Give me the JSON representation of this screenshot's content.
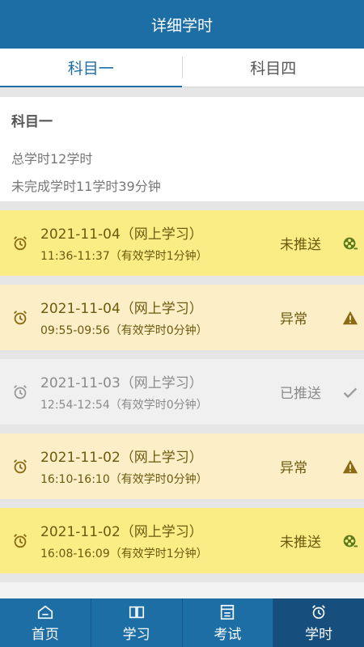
{
  "header": {
    "title": "详细学时"
  },
  "tabs": [
    {
      "label": "科目一",
      "active": true
    },
    {
      "label": "科目四",
      "active": false
    }
  ],
  "summary": {
    "subject": "科目一",
    "total": "总学时12学时",
    "remaining": "未完成学时11学时39分钟"
  },
  "records": [
    {
      "date": "2021-11-04（网上学习）",
      "time": "11:36-11:37（有效学时1分钟）",
      "status": "未推送",
      "status_icon": "film-reel-icon",
      "theme": "yellow"
    },
    {
      "date": "2021-11-04（网上学习）",
      "time": "09:55-09:56（有效学时0分钟）",
      "status": "异常",
      "status_icon": "warning-icon",
      "theme": "peach"
    },
    {
      "date": "2021-11-03（网上学习）",
      "time": "12:54-12:54（有效学时0分钟）",
      "status": "已推送",
      "status_icon": "check-icon",
      "theme": "grey"
    },
    {
      "date": "2021-11-02（网上学习）",
      "time": "16:10-16:10（有效学时0分钟）",
      "status": "异常",
      "status_icon": "warning-icon",
      "theme": "peach"
    },
    {
      "date": "2021-11-02（网上学习）",
      "time": "16:08-16:09（有效学时1分钟）",
      "status": "未推送",
      "status_icon": "film-reel-icon",
      "theme": "yellow"
    }
  ],
  "nav": [
    {
      "label": "首页",
      "icon": "home-icon"
    },
    {
      "label": "学习",
      "icon": "book-icon"
    },
    {
      "label": "考试",
      "icon": "exam-icon"
    },
    {
      "label": "学时",
      "icon": "clock-icon",
      "active": true
    }
  ],
  "colors": {
    "primary": "#1e6ea6",
    "yellow_row": "#fbed86",
    "peach_row": "#fcefc8",
    "grey_row": "#f0f0f0",
    "warning": "#8a6a12",
    "reel": "#5b7a1a"
  }
}
